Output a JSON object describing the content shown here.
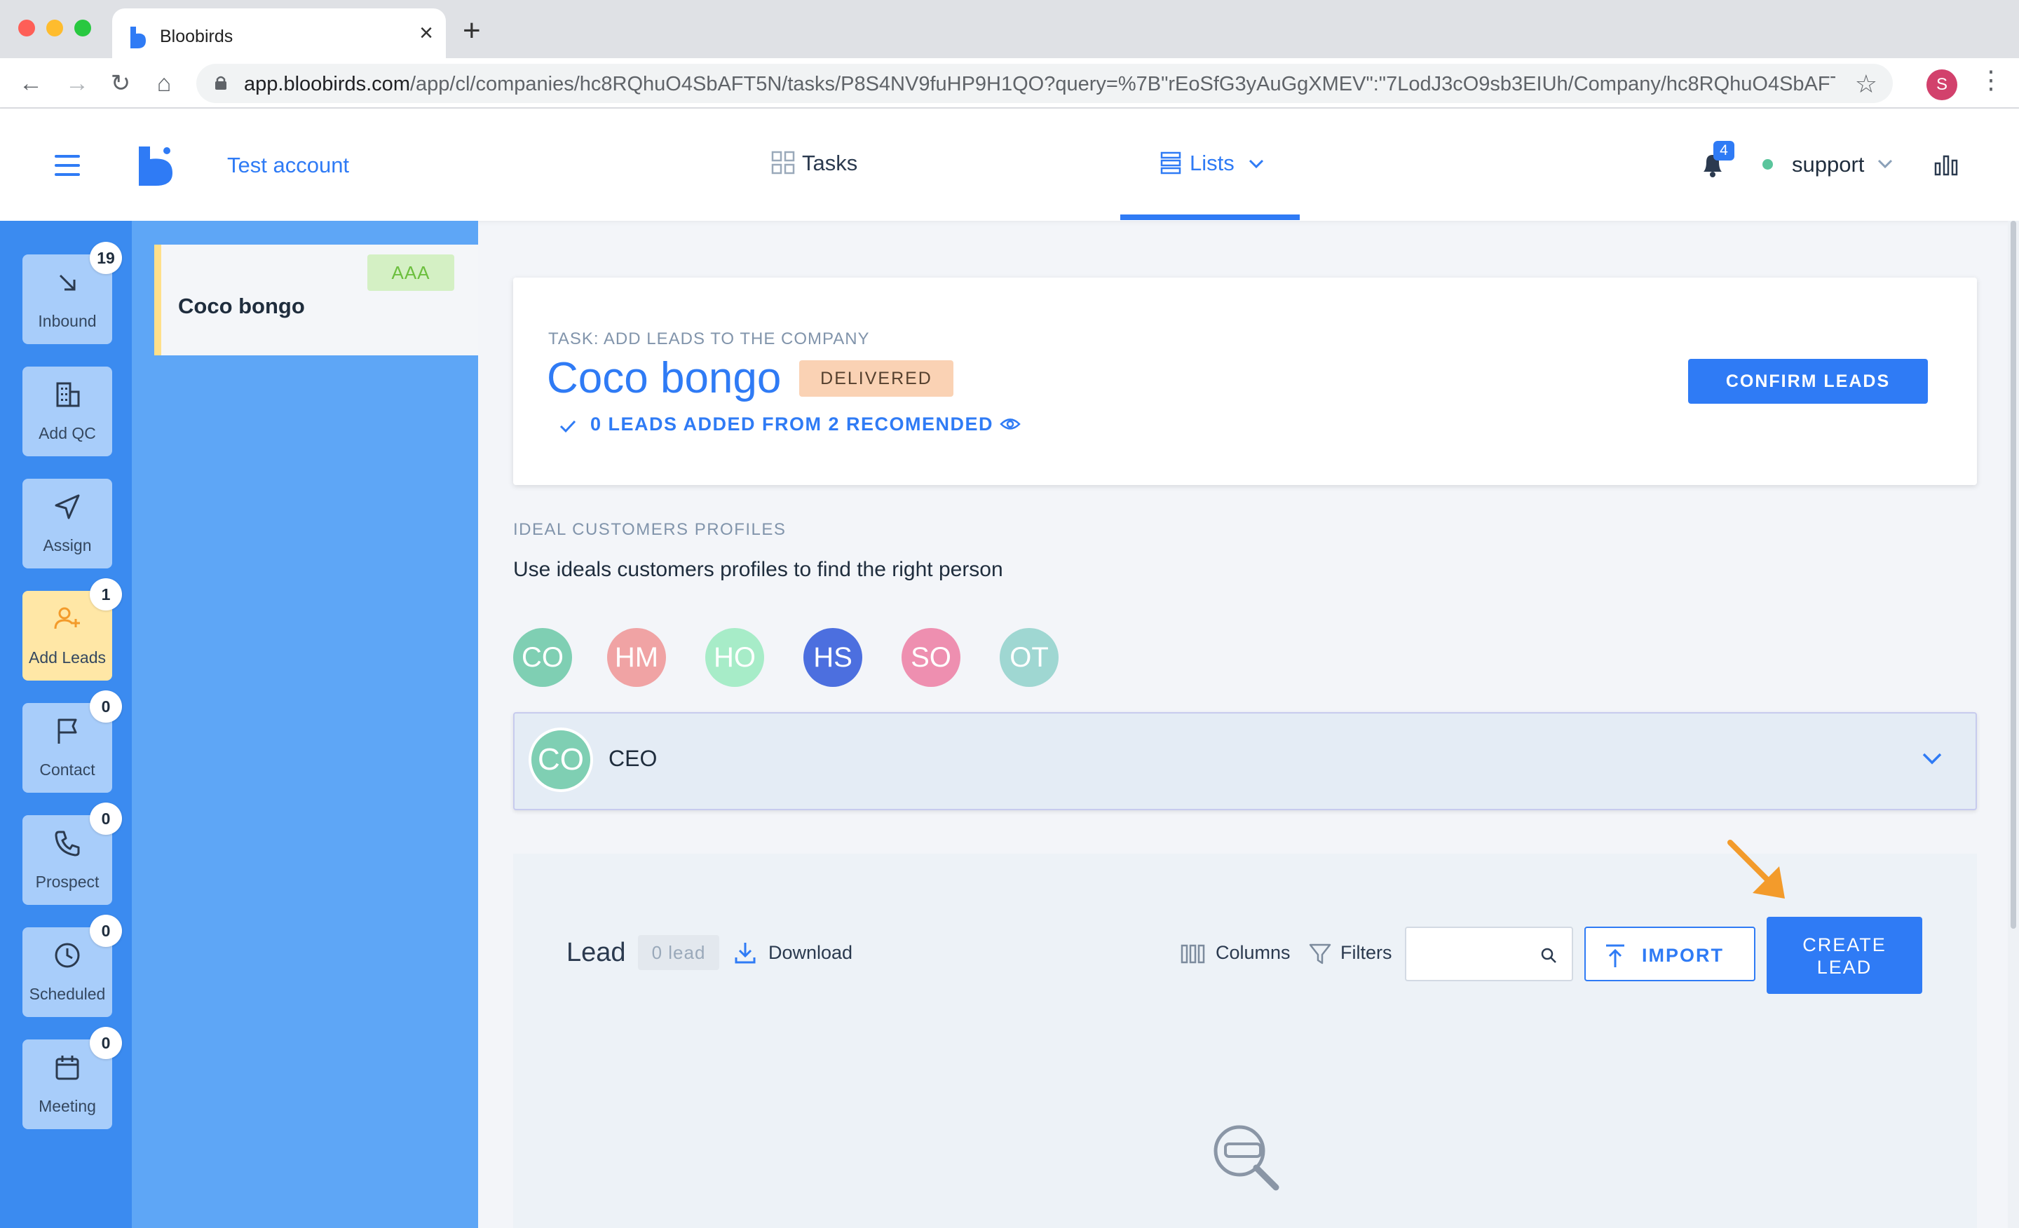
{
  "browser": {
    "tab_title": "Bloobirds",
    "url_host": "app.bloobirds.com",
    "url_path": "/app/cl/companies/hc8RQhuO4SbAFT5N/tasks/P8S4NV9fuHP9H1QO?query=%7B\"rEoSfG3yAuGgXMEV\":\"7LodJ3cO9sb3EIUh/Company/hc8RQhuO4SbAFT5N\"%...",
    "profile_initial": "S"
  },
  "header": {
    "account": "Test account",
    "nav_tasks": "Tasks",
    "nav_lists": "Lists",
    "notifications_count": "4",
    "user": "support"
  },
  "rail": {
    "items": [
      {
        "label": "Inbound",
        "badge": "19",
        "icon": "arrow-down-right-icon"
      },
      {
        "label": "Add QC",
        "badge": "",
        "icon": "building-icon"
      },
      {
        "label": "Assign",
        "badge": "",
        "icon": "send-icon"
      },
      {
        "label": "Add Leads",
        "badge": "1",
        "icon": "user-plus-icon"
      },
      {
        "label": "Contact",
        "badge": "0",
        "icon": "flag-icon"
      },
      {
        "label": "Prospect",
        "badge": "0",
        "icon": "phone-icon"
      },
      {
        "label": "Scheduled",
        "badge": "0",
        "icon": "clock-icon"
      },
      {
        "label": "Meeting",
        "badge": "0",
        "icon": "calendar-icon"
      }
    ]
  },
  "company_list": {
    "items": [
      {
        "name": "Coco bongo",
        "tag": "AAA"
      }
    ]
  },
  "task": {
    "eyebrow": "TASK: ADD LEADS TO THE COMPANY",
    "company": "Coco bongo",
    "status": "DELIVERED",
    "progress": "0 LEADS ADDED FROM 2 RECOMENDED",
    "confirm_label": "CONFIRM LEADS"
  },
  "icp": {
    "title": "IDEAL CUSTOMERS PROFILES",
    "subtitle": "Use ideals customers profiles to find the right person",
    "avatars": [
      {
        "initials": "CO",
        "color": "#7fcfb3"
      },
      {
        "initials": "HM",
        "color": "#f0a3a4"
      },
      {
        "initials": "HO",
        "color": "#a7ecc8"
      },
      {
        "initials": "HS",
        "color": "#4c6fdf"
      },
      {
        "initials": "SO",
        "color": "#ee8fb0"
      },
      {
        "initials": "OT",
        "color": "#9fd7d2"
      }
    ],
    "selected": {
      "initials": "CO",
      "label": "CEO"
    }
  },
  "leads": {
    "title": "Lead",
    "count": "0 lead",
    "download": "Download",
    "columns": "Columns",
    "filters": "Filters",
    "search_placeholder": "",
    "import_label": "IMPORT",
    "create_label_line1": "CREATE",
    "create_label_line2": "LEAD"
  },
  "colors": {
    "accent": "#2f7bf5",
    "rail": "#3b8bf0",
    "annotation_arrow": "#f39b2b"
  }
}
